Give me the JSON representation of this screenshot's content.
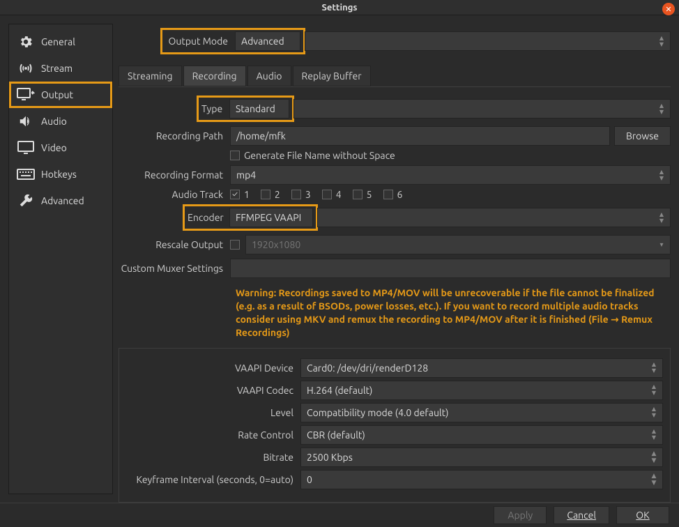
{
  "window": {
    "title": "Settings"
  },
  "sidebar": {
    "items": [
      {
        "label": "General"
      },
      {
        "label": "Stream"
      },
      {
        "label": "Output"
      },
      {
        "label": "Audio"
      },
      {
        "label": "Video"
      },
      {
        "label": "Hotkeys"
      },
      {
        "label": "Advanced"
      }
    ]
  },
  "output_mode": {
    "label": "Output Mode",
    "value": "Advanced"
  },
  "tabs": {
    "items": [
      "Streaming",
      "Recording",
      "Audio",
      "Replay Buffer"
    ],
    "active": "Recording"
  },
  "recording": {
    "type_label": "Type",
    "type_value": "Standard",
    "path_label": "Recording Path",
    "path_value": "/home/mfk",
    "browse_label": "Browse",
    "gen_no_space": "Generate File Name without Space",
    "format_label": "Recording Format",
    "format_value": "mp4",
    "audio_track_label": "Audio Track",
    "audio_tracks": [
      "1",
      "2",
      "3",
      "4",
      "5",
      "6"
    ],
    "encoder_label": "Encoder",
    "encoder_value": "FFMPEG VAAPI",
    "rescale_label": "Rescale Output",
    "rescale_value": "1920x1080",
    "muxer_label": "Custom Muxer Settings",
    "warning": "Warning: Recordings saved to MP4/MOV will be unrecoverable if the file cannot be finalized (e.g. as a result of BSODs, power losses, etc.). If you want to record multiple audio tracks consider using MKV and remux the recording to MP4/MOV after it is finished (File → Remux Recordings)"
  },
  "encoder_settings": {
    "vaapi_device_label": "VAAPI Device",
    "vaapi_device_value": "Card0: /dev/dri/renderD128",
    "vaapi_codec_label": "VAAPI Codec",
    "vaapi_codec_value": "H.264 (default)",
    "level_label": "Level",
    "level_value": "Compatibility mode  (4.0 default)",
    "rate_control_label": "Rate Control",
    "rate_control_value": "CBR (default)",
    "bitrate_label": "Bitrate",
    "bitrate_value": "2500 Kbps",
    "keyframe_label": "Keyframe Interval (seconds, 0=auto)",
    "keyframe_value": "0"
  },
  "footer": {
    "apply": "Apply",
    "cancel": "Cancel",
    "ok": "OK"
  }
}
